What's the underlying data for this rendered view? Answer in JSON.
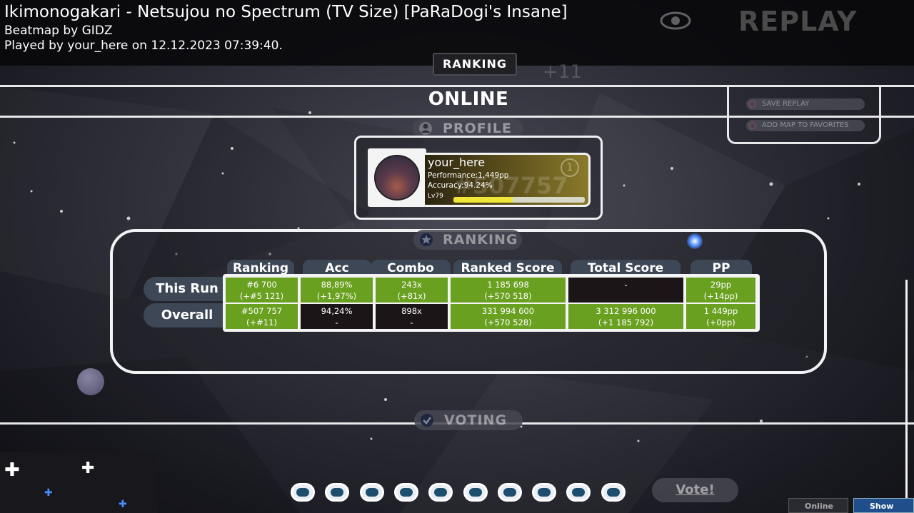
{
  "header": {
    "song_title": "Ikimonogakari - Netsujou no Spectrum (TV Size) [PaRaDogi's Insane]",
    "beatmap_by": "Beatmap by GIDZ",
    "played_by": "Played by your_here on 12.12.2023 07:39:40.",
    "replay_label": "REPLAY",
    "ghost_combo": "+11"
  },
  "tabs": {
    "ranking": "RANKING"
  },
  "online": {
    "title": "ONLINE",
    "side_menu": [
      "SAVE REPLAY",
      "ADD MAP TO FAVORITES"
    ]
  },
  "profile": {
    "section_label": "PROFILE",
    "username": "your_here",
    "performance": "Performance:1,449pp",
    "accuracy": "Accuracy:94.24%",
    "level": "Lv79",
    "rank_big": "#507757",
    "rank_icon": "1",
    "level_progress": 0.45
  },
  "ranking": {
    "section_label": "RANKING",
    "columns": [
      "Ranking",
      "Acc",
      "Combo",
      "Ranked Score",
      "Total Score",
      "PP"
    ],
    "rows": [
      {
        "label": "This Run",
        "cells": [
          {
            "top": "#6 700",
            "bottom": "(+#5 121)",
            "style": "green"
          },
          {
            "top": "88,89%",
            "bottom": "(+1,97%)",
            "style": "green"
          },
          {
            "top": "243x",
            "bottom": "(+81x)",
            "style": "green"
          },
          {
            "top": "1 185 698",
            "bottom": "(+570 518)",
            "style": "green"
          },
          {
            "top": "-",
            "bottom": "",
            "style": "dark"
          },
          {
            "top": "29pp",
            "bottom": "(+14pp)",
            "style": "green"
          }
        ]
      },
      {
        "label": "Overall",
        "cells": [
          {
            "top": "#507 757",
            "bottom": "(+#11)",
            "style": "green"
          },
          {
            "top": "94,24%",
            "bottom": "-",
            "style": "dark"
          },
          {
            "top": "898x",
            "bottom": "-",
            "style": "dark"
          },
          {
            "top": "331 994 600",
            "bottom": "(+570 528)",
            "style": "green"
          },
          {
            "top": "3 312 996 000",
            "bottom": "(+1 185 792)",
            "style": "green"
          },
          {
            "top": "1 449pp",
            "bottom": "(+0pp)",
            "style": "green"
          }
        ]
      }
    ]
  },
  "voting": {
    "section_label": "VOTING",
    "vote_button": "Vote!",
    "rating_slots": 10
  },
  "footer": {
    "online_users": "Online Users",
    "show_chat": "Show Chat"
  },
  "colors": {
    "cell_green": "#6aa020",
    "cell_dark": "#1b1518",
    "tab_bg": "#3e4756",
    "chat_blue": "#1f4e8a"
  }
}
